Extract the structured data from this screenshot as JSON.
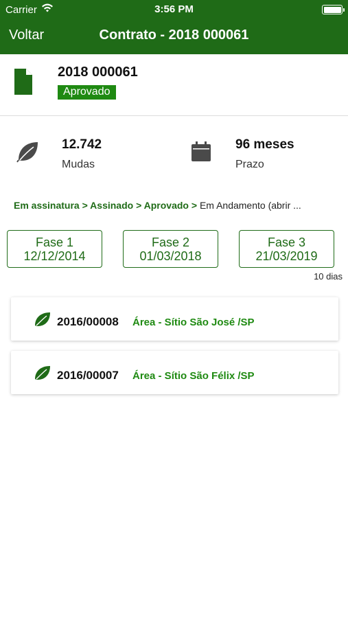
{
  "status_bar": {
    "carrier": "Carrier",
    "time": "3:56 PM"
  },
  "nav": {
    "back_label": "Voltar",
    "title": "Contrato - 2018 000061"
  },
  "contract": {
    "number": "2018 000061",
    "status": "Aprovado"
  },
  "stats": {
    "mudas": {
      "value": "12.742",
      "label": "Mudas",
      "icon": "leaf-icon"
    },
    "prazo": {
      "value": "96 meses",
      "label": "Prazo",
      "icon": "calendar-icon"
    }
  },
  "timeline": {
    "step1": "Em assinatura",
    "step2": "Assinado",
    "step3": "Aprovado",
    "current": "Em Andamento (abrir ...",
    "separator": ">"
  },
  "phases": [
    {
      "label": "Fase 1",
      "date": "12/12/2014"
    },
    {
      "label": "Fase 2",
      "date": "01/03/2018"
    },
    {
      "label": "Fase 3",
      "date": "21/03/2019"
    }
  ],
  "days_label": "10 dias",
  "areas": [
    {
      "code": "2016/00008",
      "name": "Área - Sítio São José /SP"
    },
    {
      "code": "2016/00007",
      "name": "Área - Sítio São Félix /SP"
    }
  ],
  "colors": {
    "primary": "#1f6b17",
    "accent": "#1f8a12",
    "icon_gray": "#4a4a4a"
  }
}
